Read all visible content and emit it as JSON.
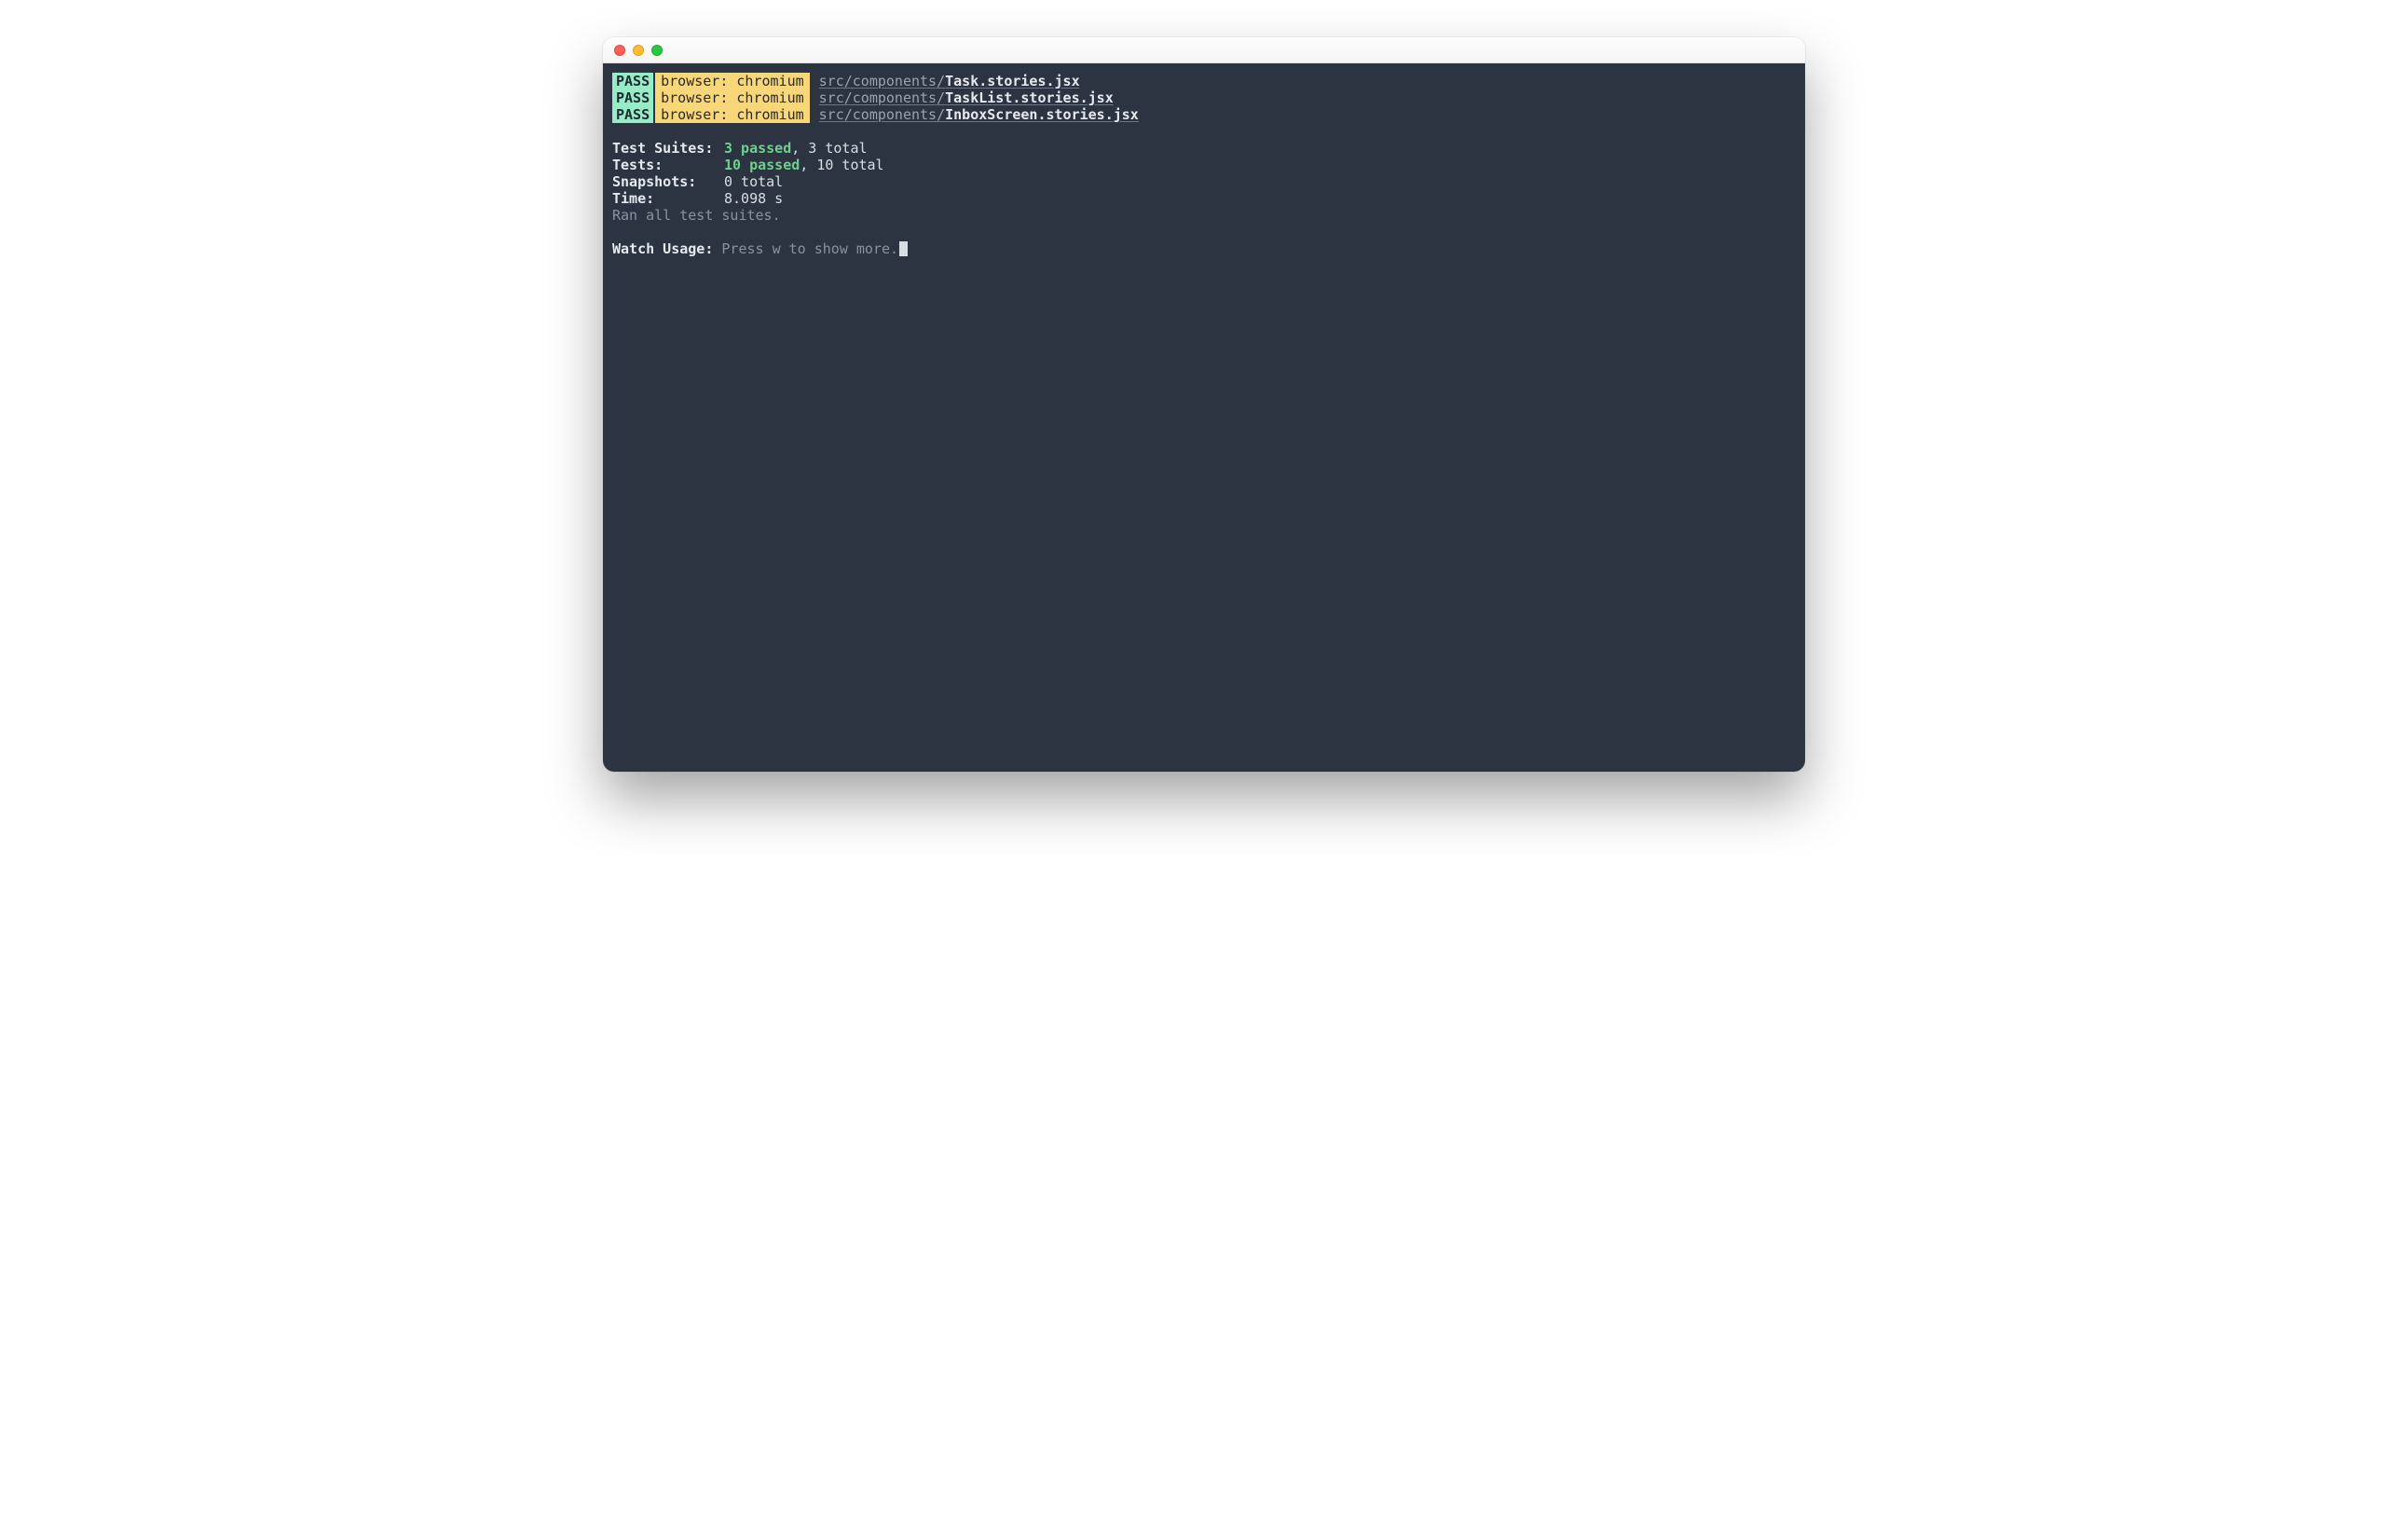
{
  "results": [
    {
      "status": "PASS",
      "browser": "browser: chromium",
      "pathDir": "src/components/",
      "pathFile": "Task.stories.jsx"
    },
    {
      "status": "PASS",
      "browser": "browser: chromium",
      "pathDir": "src/components/",
      "pathFile": "TaskList.stories.jsx"
    },
    {
      "status": "PASS",
      "browser": "browser: chromium",
      "pathDir": "src/components/",
      "pathFile": "InboxScreen.stories.jsx"
    }
  ],
  "summary": {
    "testSuitesLabel": "Test Suites:",
    "testSuitesPassed": "3 passed",
    "testSuitesTotal": ", 3 total",
    "testsLabel": "Tests:",
    "testsPassed": "10 passed",
    "testsTotal": ", 10 total",
    "snapshotsLabel": "Snapshots:",
    "snapshotsValue": "0 total",
    "timeLabel": "Time:",
    "timeValue": "8.098 s",
    "ranAll": "Ran all test suites."
  },
  "watch": {
    "label": "Watch Usage:",
    "hint": " Press w to show more."
  }
}
